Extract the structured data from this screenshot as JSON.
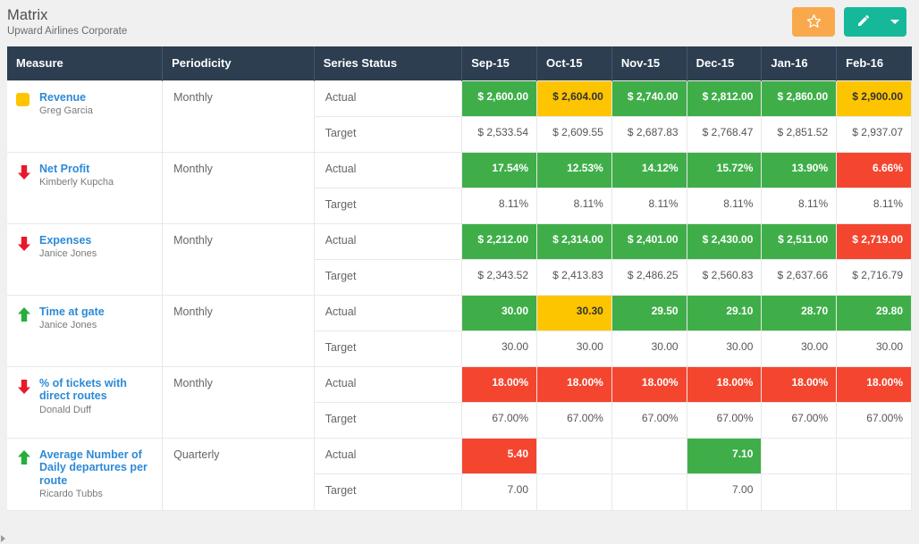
{
  "header": {
    "title": "Matrix",
    "subtitle": "Upward Airlines Corporate",
    "star_button_icon": "star-icon",
    "edit_button_icon": "pencil-icon",
    "caret_icon": "chevron-down-icon",
    "star_color": "#f9a94c",
    "edit_color": "#15b99a"
  },
  "table": {
    "columns": {
      "measure": "Measure",
      "periodicity": "Periodicity",
      "series_status": "Series Status",
      "months": [
        "Sep-15",
        "Oct-15",
        "Nov-15",
        "Dec-15",
        "Jan-16",
        "Feb-16"
      ]
    },
    "series_labels": {
      "actual": "Actual",
      "target": "Target"
    },
    "status_colors": {
      "green": "#3fae49",
      "red": "#f4452f",
      "yellow": "#fdc500",
      "header": "#2c3e50",
      "link": "#2c8ad6"
    },
    "rows": [
      {
        "name": "Revenue",
        "owner": "Greg Garcia",
        "trend": "square-swatch-icon",
        "trend_color": "#fdc500",
        "periodicity": "Monthly",
        "actual": [
          {
            "value": "$ 2,600.00",
            "status": "green"
          },
          {
            "value": "$ 2,604.00",
            "status": "yellow"
          },
          {
            "value": "$ 2,740.00",
            "status": "green"
          },
          {
            "value": "$ 2,812.00",
            "status": "green"
          },
          {
            "value": "$ 2,860.00",
            "status": "green"
          },
          {
            "value": "$ 2,900.00",
            "status": "yellow"
          }
        ],
        "target": [
          {
            "value": "$ 2,533.54"
          },
          {
            "value": "$ 2,609.55"
          },
          {
            "value": "$ 2,687.83"
          },
          {
            "value": "$ 2,768.47"
          },
          {
            "value": "$ 2,851.52"
          },
          {
            "value": "$ 2,937.07"
          }
        ]
      },
      {
        "name": "Net Profit",
        "owner": "Kimberly Kupcha",
        "trend": "arrow-down-icon",
        "trend_color": "#e8192c",
        "periodicity": "Monthly",
        "actual": [
          {
            "value": "17.54%",
            "status": "green"
          },
          {
            "value": "12.53%",
            "status": "green"
          },
          {
            "value": "14.12%",
            "status": "green"
          },
          {
            "value": "15.72%",
            "status": "green"
          },
          {
            "value": "13.90%",
            "status": "green"
          },
          {
            "value": "6.66%",
            "status": "red"
          }
        ],
        "target": [
          {
            "value": "8.11%"
          },
          {
            "value": "8.11%"
          },
          {
            "value": "8.11%"
          },
          {
            "value": "8.11%"
          },
          {
            "value": "8.11%"
          },
          {
            "value": "8.11%"
          }
        ]
      },
      {
        "name": "Expenses",
        "owner": "Janice Jones",
        "trend": "arrow-down-icon",
        "trend_color": "#e8192c",
        "periodicity": "Monthly",
        "actual": [
          {
            "value": "$ 2,212.00",
            "status": "green"
          },
          {
            "value": "$ 2,314.00",
            "status": "green"
          },
          {
            "value": "$ 2,401.00",
            "status": "green"
          },
          {
            "value": "$ 2,430.00",
            "status": "green"
          },
          {
            "value": "$ 2,511.00",
            "status": "green"
          },
          {
            "value": "$ 2,719.00",
            "status": "red"
          }
        ],
        "target": [
          {
            "value": "$ 2,343.52"
          },
          {
            "value": "$ 2,413.83"
          },
          {
            "value": "$ 2,486.25"
          },
          {
            "value": "$ 2,560.83"
          },
          {
            "value": "$ 2,637.66"
          },
          {
            "value": "$ 2,716.79"
          }
        ]
      },
      {
        "name": "Time at gate",
        "owner": "Janice Jones",
        "trend": "arrow-up-icon",
        "trend_color": "#27ae3c",
        "periodicity": "Monthly",
        "actual": [
          {
            "value": "30.00",
            "status": "green"
          },
          {
            "value": "30.30",
            "status": "yellow"
          },
          {
            "value": "29.50",
            "status": "green"
          },
          {
            "value": "29.10",
            "status": "green"
          },
          {
            "value": "28.70",
            "status": "green"
          },
          {
            "value": "29.80",
            "status": "green"
          }
        ],
        "target": [
          {
            "value": "30.00"
          },
          {
            "value": "30.00"
          },
          {
            "value": "30.00"
          },
          {
            "value": "30.00"
          },
          {
            "value": "30.00"
          },
          {
            "value": "30.00"
          }
        ]
      },
      {
        "name": "% of tickets with direct routes",
        "owner": "Donald Duff",
        "trend": "arrow-down-icon",
        "trend_color": "#e8192c",
        "periodicity": "Monthly",
        "actual": [
          {
            "value": "18.00%",
            "status": "red"
          },
          {
            "value": "18.00%",
            "status": "red"
          },
          {
            "value": "18.00%",
            "status": "red"
          },
          {
            "value": "18.00%",
            "status": "red"
          },
          {
            "value": "18.00%",
            "status": "red"
          },
          {
            "value": "18.00%",
            "status": "red"
          }
        ],
        "target": [
          {
            "value": "67.00%"
          },
          {
            "value": "67.00%"
          },
          {
            "value": "67.00%"
          },
          {
            "value": "67.00%"
          },
          {
            "value": "67.00%"
          },
          {
            "value": "67.00%"
          }
        ]
      },
      {
        "name": "Average Number of Daily departures per route",
        "owner": "Ricardo Tubbs",
        "trend": "arrow-up-icon",
        "trend_color": "#27ae3c",
        "periodicity": "Quarterly",
        "actual": [
          {
            "value": "5.40",
            "status": "red"
          },
          {
            "value": "",
            "status": "blank"
          },
          {
            "value": "",
            "status": "blank"
          },
          {
            "value": "7.10",
            "status": "green"
          },
          {
            "value": "",
            "status": "blank"
          },
          {
            "value": "",
            "status": "blank"
          }
        ],
        "target": [
          {
            "value": "7.00"
          },
          {
            "value": ""
          },
          {
            "value": ""
          },
          {
            "value": "7.00"
          },
          {
            "value": ""
          },
          {
            "value": ""
          }
        ]
      }
    ]
  }
}
